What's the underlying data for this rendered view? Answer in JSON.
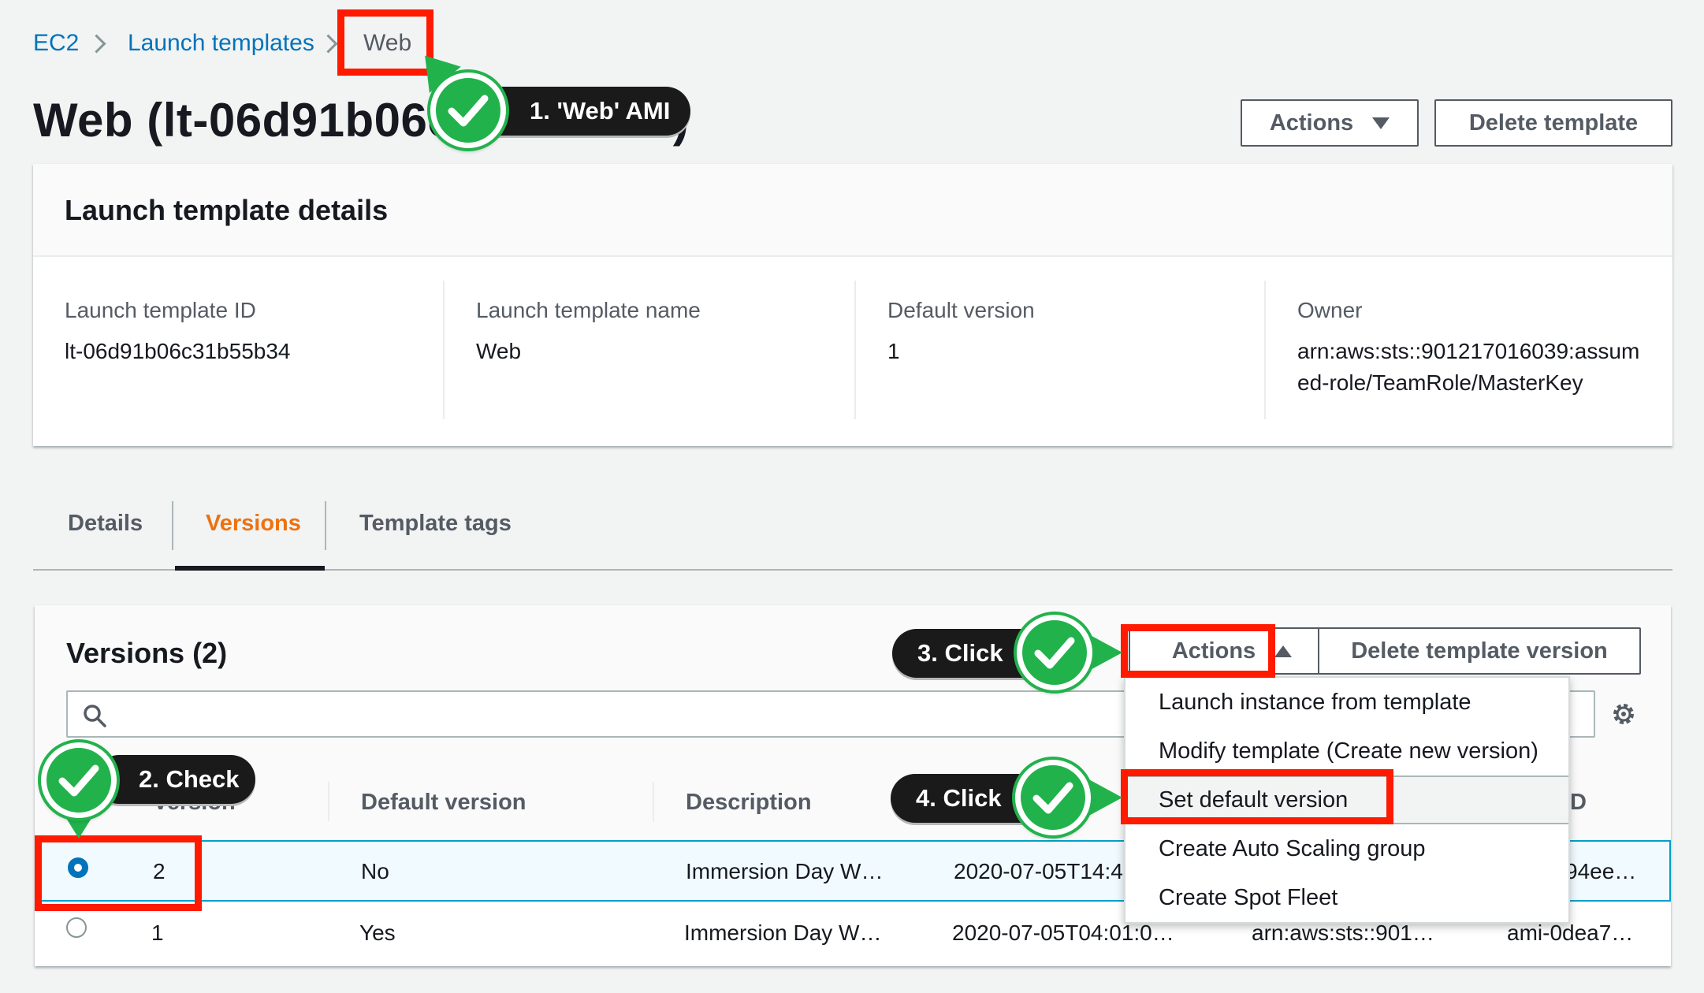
{
  "breadcrumb": {
    "root": "EC2",
    "parent": "Launch templates",
    "current": "Web"
  },
  "page_title": "Web (lt-06d91b06c31b55b34)",
  "header_actions": {
    "actions": "Actions",
    "delete": "Delete template"
  },
  "details": {
    "title": "Launch template details",
    "fields": [
      {
        "label": "Launch template ID",
        "value": "lt-06d91b06c31b55b34"
      },
      {
        "label": "Launch template name",
        "value": "Web"
      },
      {
        "label": "Default version",
        "value": "1"
      },
      {
        "label": "Owner",
        "value": "arn:aws:sts::901217016039:assumed-role/TeamRole/MasterKey"
      }
    ],
    "owner_line1": "arn:aws:sts::901217016039:assum",
    "owner_line2": "ed-role/TeamRole/MasterKey"
  },
  "tabs": [
    {
      "label": "Details",
      "active": false
    },
    {
      "label": "Versions",
      "active": true
    },
    {
      "label": "Template tags",
      "active": false
    }
  ],
  "versions": {
    "title": "Versions (2)",
    "actions": "Actions",
    "delete_version": "Delete template version",
    "search_placeholder": "",
    "columns": [
      "Version",
      "Default version",
      "Description",
      "",
      "",
      "ID"
    ],
    "rows": [
      {
        "selected": true,
        "version": "2",
        "default": "No",
        "description": "Immersion Day W…",
        "created": "2020-07-05T14:4",
        "owner": "",
        "ami": "94ee…"
      },
      {
        "selected": false,
        "version": "1",
        "default": "Yes",
        "description": "Immersion Day W…",
        "created": "2020-07-05T04:01:0…",
        "owner": "arn:aws:sts::901…",
        "ami": "ami-0dea7…"
      }
    ],
    "menu": [
      "Launch instance from template",
      "Modify template (Create new version)",
      "Set default version",
      "Create Auto Scaling group",
      "Create Spot Fleet"
    ],
    "menu_highlight_index": 2
  },
  "annotations": {
    "step1": "1. 'Web' AMI",
    "step2": "2. Check",
    "step3": "3. Click",
    "step4": "4. Click"
  },
  "colors": {
    "link": "#0073bb",
    "active_tab": "#ec7211",
    "highlight": "#ff1a00",
    "badge": "#22b24c",
    "selected_row": "#f1faff"
  },
  "icons": [
    "search-icon",
    "gear-icon",
    "check-icon",
    "chevron-right-icon",
    "caret-down-icon",
    "caret-up-icon"
  ]
}
